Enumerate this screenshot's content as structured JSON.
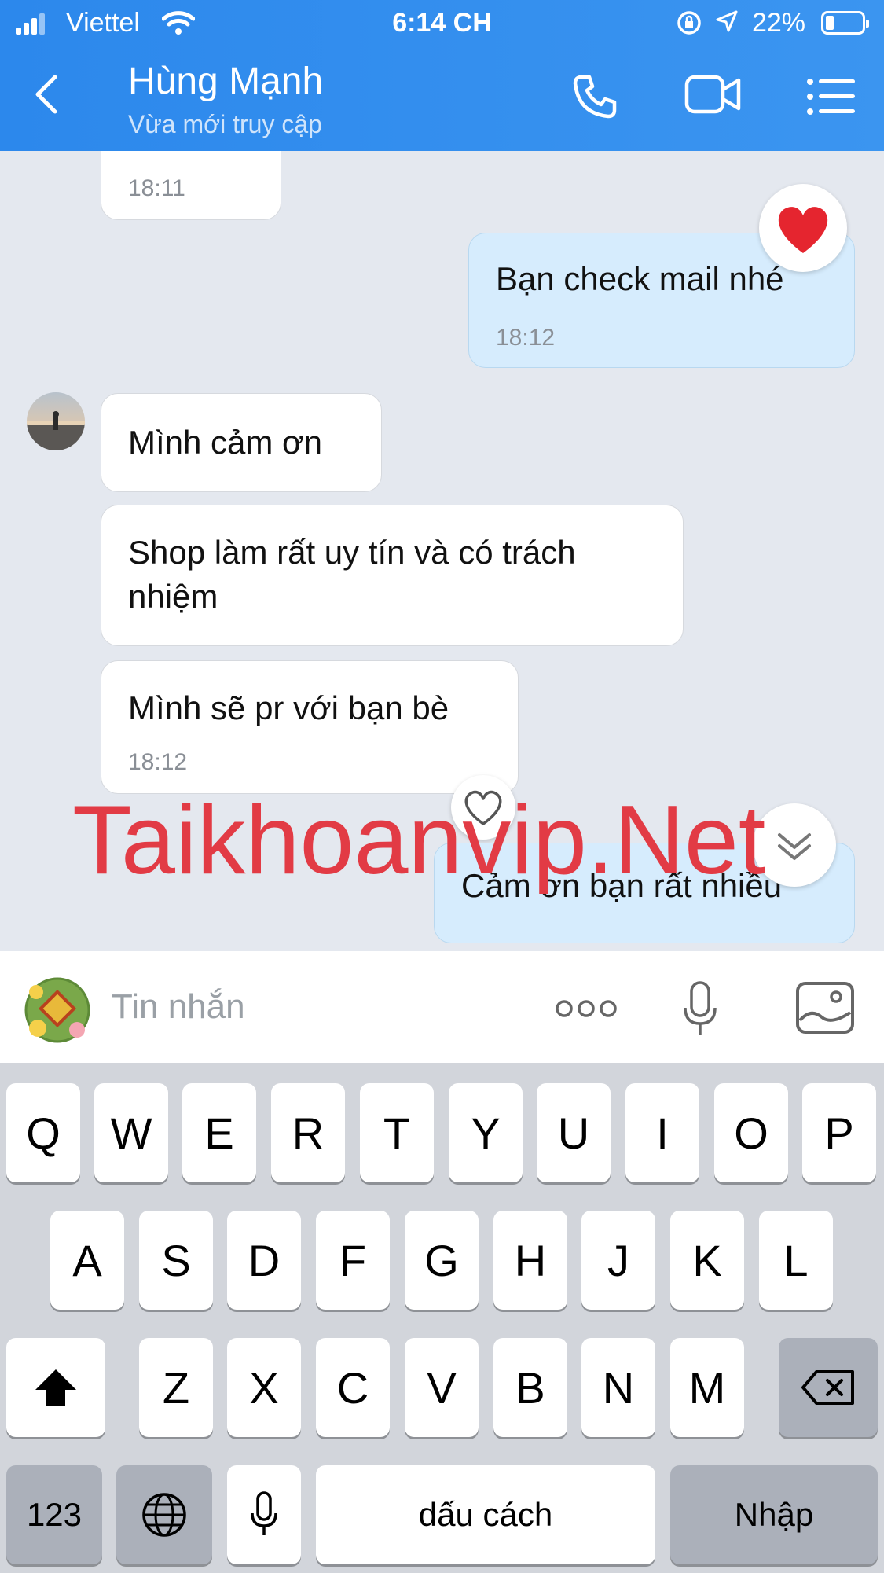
{
  "status_bar": {
    "carrier": "Viettel",
    "time": "6:14 CH",
    "battery": "22%"
  },
  "header": {
    "name": "Hùng Mạnh",
    "status": "Vừa mới truy cập"
  },
  "messages": [
    {
      "time": "18:11"
    },
    {
      "text": "Bạn check mail nhé",
      "time": "18:12"
    },
    {
      "text": "Mình cảm ơn"
    },
    {
      "text_line1": "Shop làm rất uy tín và có trách",
      "text_line2": "nhiệm"
    },
    {
      "text": "Mình sẽ pr với bạn bè",
      "time": "18:12"
    },
    {
      "text": "Cảm ơn bạn rất nhiều"
    }
  ],
  "watermark": "Taikhoanvip.Net",
  "input": {
    "placeholder": "Tin nhắn"
  },
  "keyboard": {
    "row1": [
      "Q",
      "W",
      "E",
      "R",
      "T",
      "Y",
      "U",
      "I",
      "O",
      "P"
    ],
    "row2": [
      "A",
      "S",
      "D",
      "F",
      "G",
      "H",
      "J",
      "K",
      "L"
    ],
    "row3": [
      "Z",
      "X",
      "C",
      "V",
      "B",
      "N",
      "M"
    ],
    "numbers": "123",
    "space": "dấu cách",
    "return": "Nhập"
  },
  "icons": [
    "back-icon",
    "phone-icon",
    "video-call-icon",
    "menu-icon",
    "heart-icon",
    "sticker-icon",
    "more-icon",
    "mic-icon",
    "image-icon",
    "shift-icon",
    "delete-icon",
    "globe-icon",
    "dictation-icon"
  ]
}
